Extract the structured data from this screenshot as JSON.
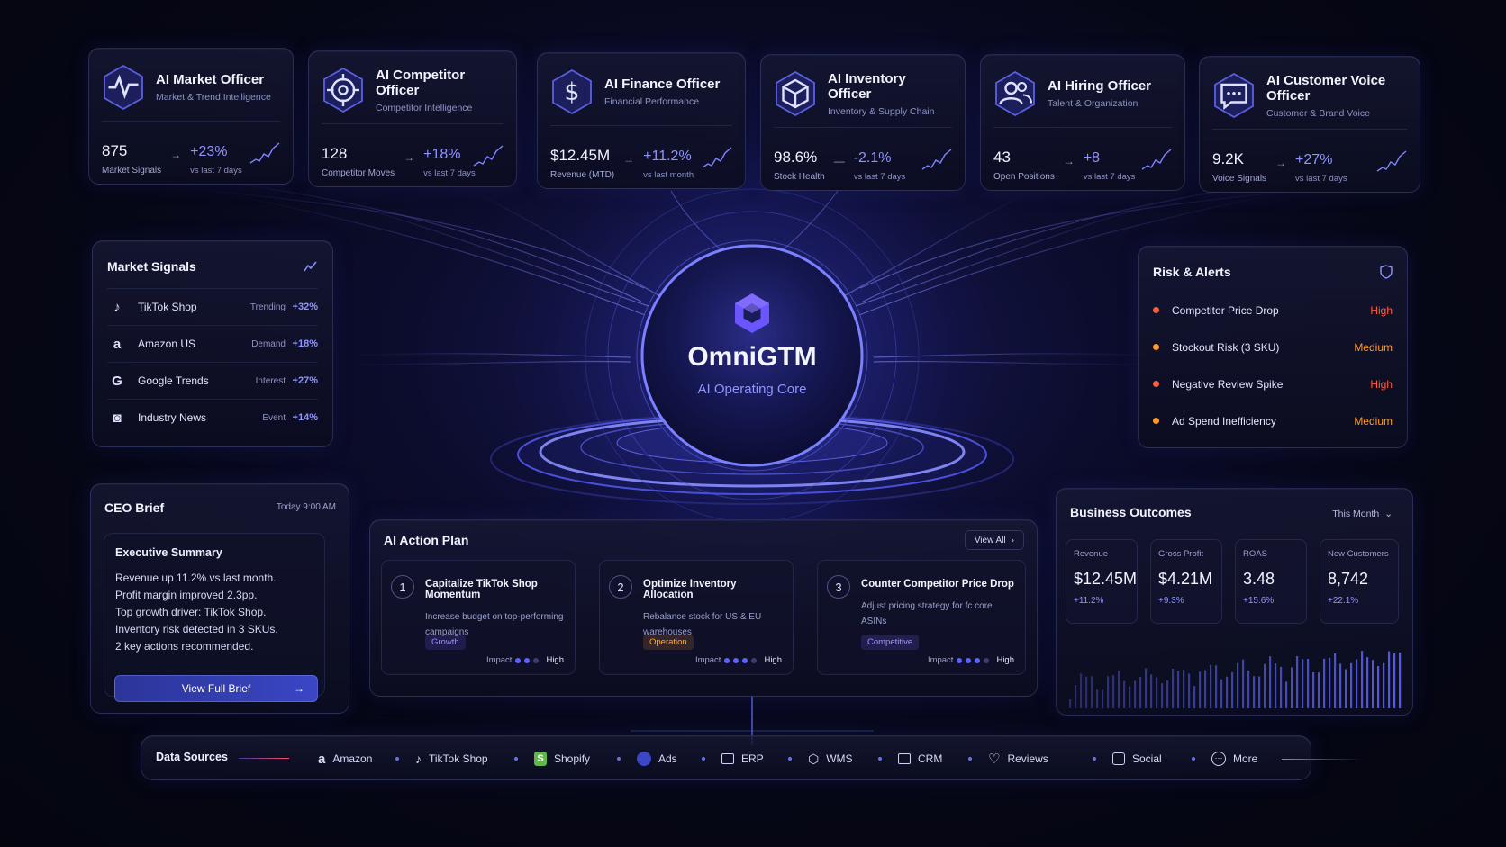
{
  "officers": [
    {
      "title": "AI Market Officer",
      "sub": "Market & Trend Intelligence",
      "value": "875",
      "label": "Market Signals",
      "change": "+23%",
      "vs": "vs last 7 days",
      "icon": "pulse-icon"
    },
    {
      "title": "AI Competitor Officer",
      "sub": "Competitor Intelligence",
      "value": "128",
      "label": "Competitor Moves",
      "change": "+18%",
      "vs": "vs last 7 days",
      "icon": "target-icon"
    },
    {
      "title": "AI Finance Officer",
      "sub": "Financial Performance",
      "value": "$12.45M",
      "label": "Revenue (MTD)",
      "change": "+11.2%",
      "vs": "vs last month",
      "icon": "dollar-icon"
    },
    {
      "title": "AI Inventory Officer",
      "sub": "Inventory & Supply Chain",
      "value": "98.6%",
      "label": "Stock Health",
      "change": "-2.1%",
      "vs": "vs last 7 days",
      "icon": "box-icon"
    },
    {
      "title": "AI Hiring Officer",
      "sub": "Talent & Organization",
      "value": "43",
      "label": "Open Positions",
      "change": "+8",
      "vs": "vs last 7 days",
      "icon": "people-icon"
    },
    {
      "title": "AI Customer Voice Officer",
      "sub": "Customer & Brand Voice",
      "value": "9.2K",
      "label": "Voice Signals",
      "change": "+27%",
      "vs": "vs last 7 days",
      "icon": "chat-icon"
    }
  ],
  "market_signals": {
    "title": "Market Signals",
    "rows": [
      {
        "name": "TikTok Shop",
        "kind": "Trending",
        "pct": "+32%",
        "icon": "tiktok-icon"
      },
      {
        "name": "Amazon US",
        "kind": "Demand",
        "pct": "+18%",
        "icon": "amazon-icon"
      },
      {
        "name": "Google Trends",
        "kind": "Interest",
        "pct": "+27%",
        "icon": "google-icon"
      },
      {
        "name": "Industry News",
        "kind": "Event",
        "pct": "+14%",
        "icon": "news-icon"
      }
    ]
  },
  "core": {
    "name": "OmniGTM",
    "subtitle": "AI Operating Core"
  },
  "risk": {
    "title": "Risk & Alerts",
    "rows": [
      {
        "name": "Competitor Price Drop",
        "level": "High",
        "color": "#ff5a3c"
      },
      {
        "name": "Stockout Risk (3 SKU)",
        "level": "Medium",
        "color": "#ff9a2a"
      },
      {
        "name": "Negative Review Spike",
        "level": "High",
        "color": "#ff5a3c"
      },
      {
        "name": "Ad Spend Inefficiency",
        "level": "Medium",
        "color": "#ff9a2a"
      }
    ]
  },
  "ceo_brief": {
    "title": "CEO Brief",
    "time": "Today 9:00 AM",
    "summary_title": "Executive Summary",
    "lines": [
      "Revenue up 11.2% vs last month.",
      "Profit margin improved 2.3pp.",
      "Top growth driver: TikTok Shop.",
      "Inventory risk detected in 3 SKUs.",
      "2 key actions recommended."
    ],
    "button": "View Full Brief"
  },
  "action_plan": {
    "title": "AI Action Plan",
    "view_all": "View All",
    "impact_label": "Impact",
    "items": [
      {
        "num": "1",
        "title": "Capitalize TikTok Shop Momentum",
        "desc": "Increase budget on top-performing campaigns",
        "tag": "Growth",
        "tag_color": "#7c6cff",
        "impact": "High"
      },
      {
        "num": "2",
        "title": "Optimize Inventory Allocation",
        "desc": "Rebalance stock for US & EU warehouses",
        "tag": "Operation",
        "tag_color": "#ff9a2a",
        "impact": "High"
      },
      {
        "num": "3",
        "title": "Counter Competitor Price Drop",
        "desc": "Adjust pricing strategy for fc core ASINs",
        "tag": "Competitive",
        "tag_color": "#8f7cff",
        "impact": "High"
      }
    ]
  },
  "outcomes": {
    "title": "Business Outcomes",
    "period": "This Month",
    "kpis": [
      {
        "label": "Revenue",
        "value": "$12.45M",
        "change": "+11.2%"
      },
      {
        "label": "Gross Profit",
        "value": "$4.21M",
        "change": "+9.3%"
      },
      {
        "label": "ROAS",
        "value": "3.48",
        "change": "+15.6%"
      },
      {
        "label": "New Customers",
        "value": "8,742",
        "change": "+22.1%"
      }
    ]
  },
  "data_sources": {
    "title": "Data Sources",
    "items": [
      {
        "name": "Amazon",
        "icon": "amazon-icon"
      },
      {
        "name": "TikTok Shop",
        "icon": "tiktok-icon"
      },
      {
        "name": "Shopify",
        "icon": "shopify-icon"
      },
      {
        "name": "Ads",
        "icon": "ads-icon"
      },
      {
        "name": "ERP",
        "icon": "erp-icon"
      },
      {
        "name": "WMS",
        "icon": "wms-icon"
      },
      {
        "name": "CRM",
        "icon": "crm-icon"
      },
      {
        "name": "Reviews",
        "icon": "heart-icon"
      },
      {
        "name": "Social",
        "icon": "social-icon"
      },
      {
        "name": "More",
        "icon": "more-icon"
      }
    ]
  },
  "colors": {
    "accent": "#8c92ff",
    "high": "#ff5a3c",
    "medium": "#ff9a2a",
    "core_glow": "#5b63ff"
  }
}
